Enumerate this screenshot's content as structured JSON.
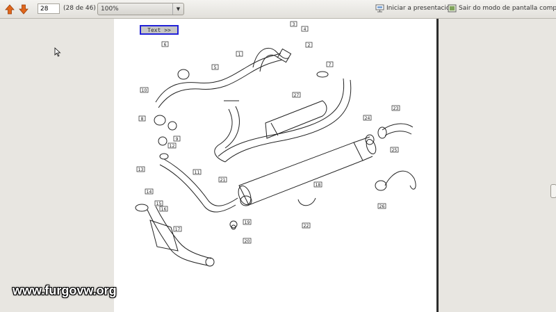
{
  "toolbar": {
    "prev_icon": "arrow-up-icon",
    "next_icon": "arrow-down-icon",
    "page_number": "28",
    "page_count": "(28 de 46)",
    "zoom": "100%",
    "presentation_label": "Iniciar a presentación",
    "fullscreen_exit_label": "Sair do modo de pantalla completa"
  },
  "document": {
    "text_button": "Text >>",
    "part_numbers": [
      "1",
      "2",
      "3",
      "4",
      "5",
      "6",
      "7",
      "8",
      "9",
      "10",
      "11",
      "12",
      "13",
      "14",
      "15",
      "16",
      "17",
      "18",
      "19",
      "20",
      "21",
      "22",
      "23",
      "24",
      "25",
      "26",
      "27"
    ]
  },
  "watermark": "www.furgovw.org",
  "colors": {
    "arrow": "#e0661b",
    "button_border": "#2222d8"
  }
}
